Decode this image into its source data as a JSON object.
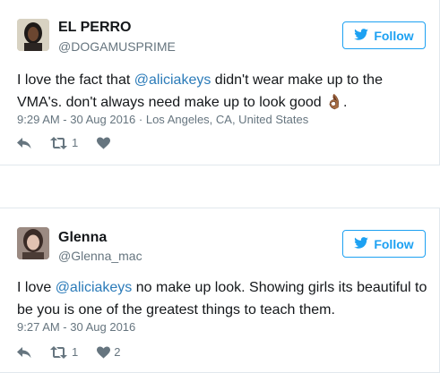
{
  "tweets": [
    {
      "name": "EL PERRO",
      "handle": "@DOGAMUSPRIME",
      "follow_label": "Follow",
      "text_before": "I love the fact that ",
      "mention": "@aliciakeys",
      "text_after": " didn't wear make up to the VMA's. don't always need make up to look good 👌🏾.",
      "timestamp": "9:29 AM - 30 Aug 2016",
      "separator": " · ",
      "location": "Los Angeles, CA, United States",
      "retweets": "1",
      "likes": ""
    },
    {
      "name": "Glenna",
      "handle": "@Glenna_mac",
      "follow_label": "Follow",
      "text_before": "I love ",
      "mention": "@aliciakeys",
      "text_after": " no make up look. Showing girls its beautiful to be you is one of the greatest things to teach them.",
      "timestamp": "9:27 AM - 30 Aug 2016",
      "separator": "",
      "location": "",
      "retweets": "1",
      "likes": "2"
    }
  ],
  "colors": {
    "accent": "#1da1f2",
    "mention": "#2b7bb9",
    "muted": "#66757f",
    "border": "#e1e8ed"
  },
  "icons": {
    "follow": "twitter-bird-icon",
    "reply": "reply-icon",
    "retweet": "retweet-icon",
    "like": "heart-icon"
  }
}
